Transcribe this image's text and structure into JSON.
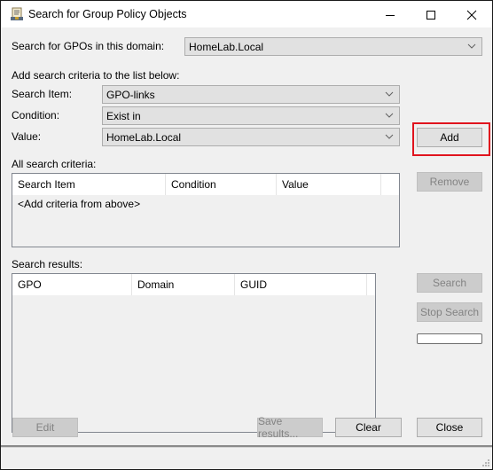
{
  "window": {
    "title": "Search for Group Policy Objects",
    "icon": "gpo-search-scroll-icon",
    "controls": [
      "minimize-icon",
      "maximize-icon",
      "close-icon"
    ]
  },
  "domain_row": {
    "label": "Search for GPOs in this domain:",
    "value": "HomeLab.Local"
  },
  "criteria_form": {
    "instruction": "Add search criteria to the list below:",
    "search_item": {
      "label": "Search Item:",
      "value": "GPO-links"
    },
    "condition": {
      "label": "Condition:",
      "value": "Exist in"
    },
    "value": {
      "label": "Value:",
      "value": "HomeLab.Local"
    }
  },
  "all_criteria": {
    "label": "All search criteria:",
    "columns": [
      "Search Item",
      "Condition",
      "Value"
    ],
    "empty_text": "<Add criteria from above>"
  },
  "results": {
    "label": "Search results:",
    "columns": [
      "GPO",
      "Domain",
      "GUID"
    ],
    "rows": []
  },
  "buttons": {
    "add": {
      "label": "Add",
      "enabled": true,
      "highlighted": true
    },
    "remove": {
      "label": "Remove",
      "enabled": false
    },
    "search": {
      "label": "Search",
      "enabled": false
    },
    "stop_search": {
      "label": "Stop Search",
      "enabled": false
    },
    "edit": {
      "label": "Edit",
      "enabled": false
    },
    "save_results": {
      "label": "Save results...",
      "enabled": false
    },
    "clear": {
      "label": "Clear",
      "enabled": true
    },
    "close": {
      "label": "Close",
      "enabled": true
    }
  },
  "progress": {
    "value": 0
  },
  "colors": {
    "highlight": "#e0141e",
    "dialog_bg": "#f0f0f0",
    "button_bg": "#e1e1e1",
    "disabled_button_bg": "#cccccc",
    "disabled_text": "#838383"
  }
}
